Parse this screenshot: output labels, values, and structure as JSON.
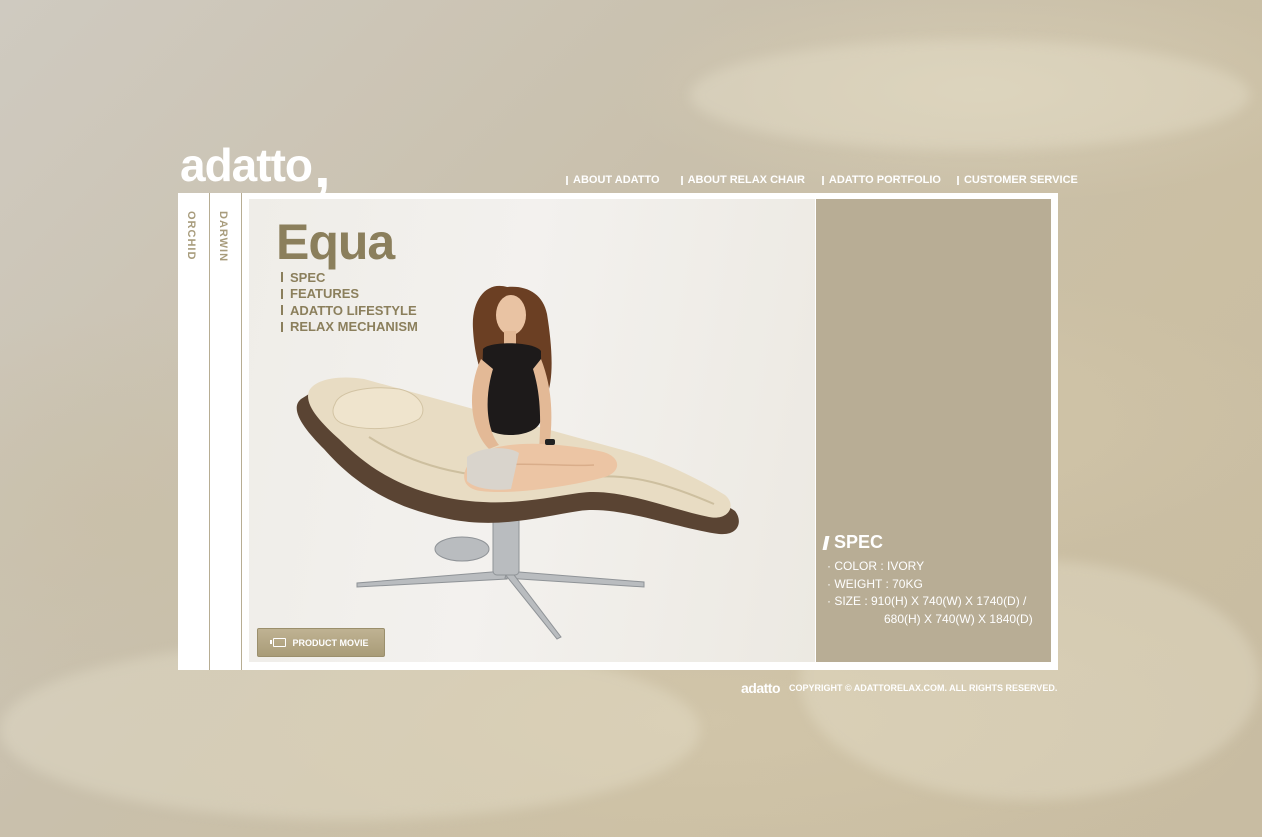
{
  "brand": {
    "logo_text": "adatto",
    "logo_mark": ","
  },
  "topnav": [
    {
      "label": "ABOUT ADATTO"
    },
    {
      "label": "ABOUT RELAX CHAIR"
    },
    {
      "label": "ADATTO PORTFOLIO"
    },
    {
      "label": "CUSTOMER SERVICE"
    }
  ],
  "side_tabs": [
    {
      "label": "ORCHID"
    },
    {
      "label": "DARWIN"
    }
  ],
  "product": {
    "name": "Equa",
    "submenu": [
      {
        "label": "SPEC"
      },
      {
        "label": "FEATURES"
      },
      {
        "label": "ADATTO LIFESTYLE"
      },
      {
        "label": "RELAX MECHANISM"
      }
    ],
    "movie_button": "PRODUCT  MOVIE"
  },
  "spec": {
    "title": "SPEC",
    "color": "· COLOR : IVORY",
    "weight": "· WEIGHT : 70KG",
    "size_line1": "· SIZE : 910(H) X 740(W) X 1740(D) /",
    "size_line2": "680(H) X 740(W) X 1840(D)"
  },
  "footer": {
    "logo_text": "adatto",
    "copyright": "COPYRIGHT ©  ADATTORELAX.COM.  ALL RIGHTS RESERVED."
  },
  "colors": {
    "accent": "#8b7f5c",
    "spec_panel": "#b8ad95",
    "tab_text": "#a89c7c",
    "chair_leather": "#e8dcc3",
    "chair_frame": "#5a4433"
  }
}
